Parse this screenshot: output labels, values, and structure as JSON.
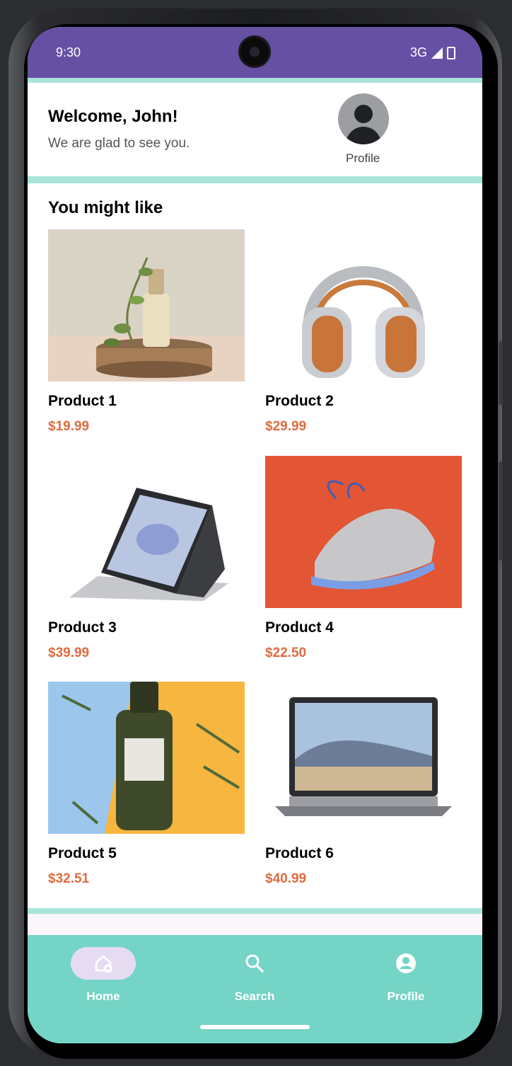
{
  "status_bar": {
    "time": "9:30",
    "network": "3G"
  },
  "header": {
    "welcome_title": "Welcome, John!",
    "welcome_subtitle": "We are glad to see you.",
    "profile_label": "Profile"
  },
  "section": {
    "title": "You might like"
  },
  "products": [
    {
      "name": "Product 1",
      "price": "$19.99",
      "image": "perfume-bottle-plant"
    },
    {
      "name": "Product 2",
      "price": "$29.99",
      "image": "headphones"
    },
    {
      "name": "Product 3",
      "price": "$39.99",
      "image": "tablet-laptop"
    },
    {
      "name": "Product 4",
      "price": "$22.50",
      "image": "sneaker"
    },
    {
      "name": "Product 5",
      "price": "$32.51",
      "image": "skincare-bottle"
    },
    {
      "name": "Product 6",
      "price": "$40.99",
      "image": "laptop"
    }
  ],
  "bottom_nav": {
    "items": [
      {
        "label": "Home",
        "icon": "home-add-icon",
        "selected": true
      },
      {
        "label": "Search",
        "icon": "search-icon",
        "selected": false
      },
      {
        "label": "Profile",
        "icon": "account-circle-icon",
        "selected": false
      }
    ]
  },
  "colors": {
    "status_bar": "#6650a4",
    "accent_divider": "#a9e4da",
    "bottom_nav": "#74d4c6",
    "price": "#e06b3f",
    "nav_pill": "#e6dcf2"
  }
}
